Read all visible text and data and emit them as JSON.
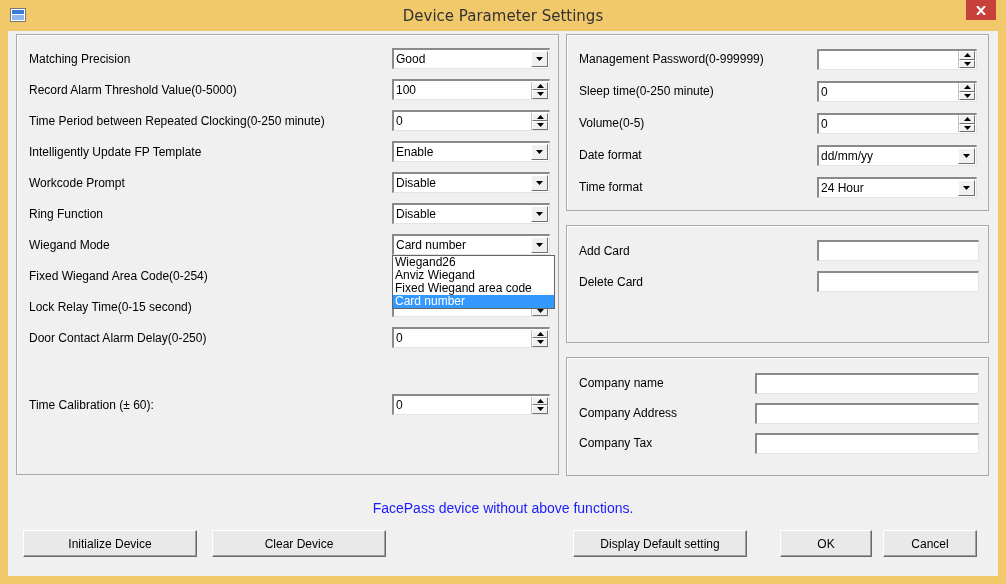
{
  "window": {
    "title": "Device Parameter Settings"
  },
  "left_panel": {
    "rows": [
      {
        "label": "Matching Precision",
        "kind": "dropdown",
        "value": "Good"
      },
      {
        "label": "Record Alarm Threshold Value(0-5000)",
        "kind": "spin",
        "value": "100"
      },
      {
        "label": "Time Period between Repeated Clocking(0-250 minute)",
        "kind": "spin",
        "value": "0"
      },
      {
        "label": "Intelligently Update FP Template",
        "kind": "dropdown",
        "value": "Enable"
      },
      {
        "label": "Workcode Prompt",
        "kind": "dropdown",
        "value": "Disable"
      },
      {
        "label": "Ring Function",
        "kind": "dropdown",
        "value": "Disable"
      },
      {
        "label": "Wiegand Mode",
        "kind": "dropdown",
        "value": "Card number",
        "open": true,
        "options": [
          {
            "label": "Wiegand26",
            "selected": false
          },
          {
            "label": "Anviz Wiegand",
            "selected": false
          },
          {
            "label": "Fixed Wiegand area code",
            "selected": false
          },
          {
            "label": "Card number",
            "selected": true
          }
        ]
      },
      {
        "label": "Fixed Wiegand Area Code(0-254)",
        "kind": "covered"
      },
      {
        "label": "Lock Relay Time(0-15 second)",
        "kind": "spin"
      },
      {
        "label": "Door Contact Alarm Delay(0-250)",
        "kind": "spin",
        "value": "0"
      }
    ],
    "bottom_rows": [
      {
        "label": "Time Calibration (± 60):",
        "kind": "spin",
        "value": "0"
      }
    ]
  },
  "right_top": {
    "rows": [
      {
        "label": "Management Password(0-999999)",
        "kind": "spin"
      },
      {
        "label": "Sleep time(0-250 minute)",
        "kind": "spin",
        "value": "0"
      },
      {
        "label": "Volume(0-5)",
        "kind": "spin",
        "value": "0"
      },
      {
        "label": "Date format",
        "kind": "dropdown",
        "value": "dd/mm/yy"
      },
      {
        "label": "Time format",
        "kind": "dropdown",
        "value": "24 Hour"
      }
    ]
  },
  "card_panel": {
    "rows": [
      {
        "label": "Add Card",
        "kind": "text"
      },
      {
        "label": "Delete Card",
        "kind": "text"
      }
    ]
  },
  "company_panel": {
    "rows": [
      {
        "label": "Company name",
        "kind": "text"
      },
      {
        "label": "Company Address",
        "kind": "text"
      },
      {
        "label": "Company Tax",
        "kind": "text"
      }
    ]
  },
  "message": "FacePass device without above functions.",
  "buttons": [
    {
      "label": "Initialize Device"
    },
    {
      "label": "Clear Device"
    },
    {
      "label": "Display Default setting"
    },
    {
      "label": "OK"
    },
    {
      "label": "Cancel"
    }
  ]
}
